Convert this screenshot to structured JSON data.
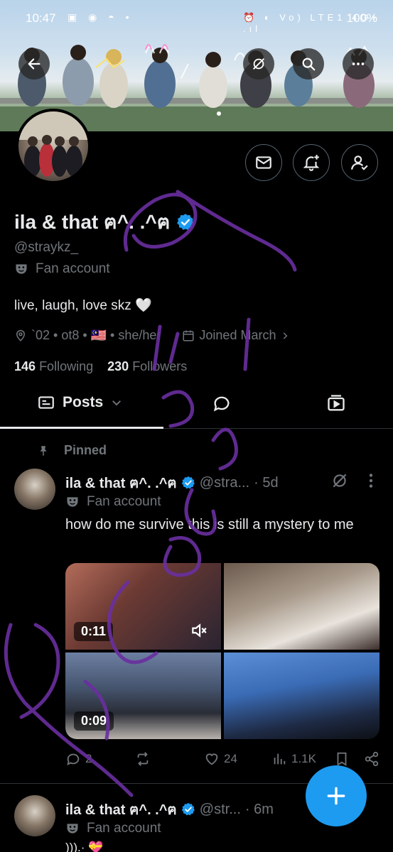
{
  "status_bar": {
    "time": "10:47",
    "battery": "100%",
    "left_icons": "▣ ◉ ◓ •",
    "right_icons": "⏰ ◐ Vo) LTE1 4G+ .ıl"
  },
  "header": {
    "back_label": "Back",
    "actions": [
      "grok-icon",
      "search-icon",
      "more-icon"
    ]
  },
  "profile": {
    "name": "ila & that ฅ^. .^ฅ",
    "handle": "@straykz_",
    "category": "Fan account",
    "bio": "live, laugh, love skz 🤍",
    "location": "`02 • ot8 • 🇲🇾 • she/her",
    "joined": "Joined March",
    "following_count": "146",
    "following_label": "Following",
    "followers_count": "230",
    "followers_label": "Followers"
  },
  "tabs": {
    "posts_label": "Posts"
  },
  "pinned_label": "Pinned",
  "posts": [
    {
      "name": "ila & that ฅ^. .^ฅ",
      "handle": "@stra...",
      "time": "· 5d",
      "category": "Fan account",
      "text": "how do me survive this is still a mystery to me",
      "media": [
        {
          "duration": "0:11"
        },
        {
          "duration": ""
        },
        {
          "duration": "0:09"
        },
        {
          "duration": ""
        }
      ],
      "replies": "2",
      "reposts": "",
      "likes": "24",
      "views": "1.1K"
    },
    {
      "name": "ila & that ฅ^. .^ฅ",
      "handle": "@str...",
      "time": "· 6m",
      "category": "Fan account",
      "text": "))).· 💝"
    }
  ],
  "colors": {
    "accent": "#1d9bf0",
    "background": "#000000",
    "muted": "#71767b",
    "doodle": "#6a2fa0"
  }
}
